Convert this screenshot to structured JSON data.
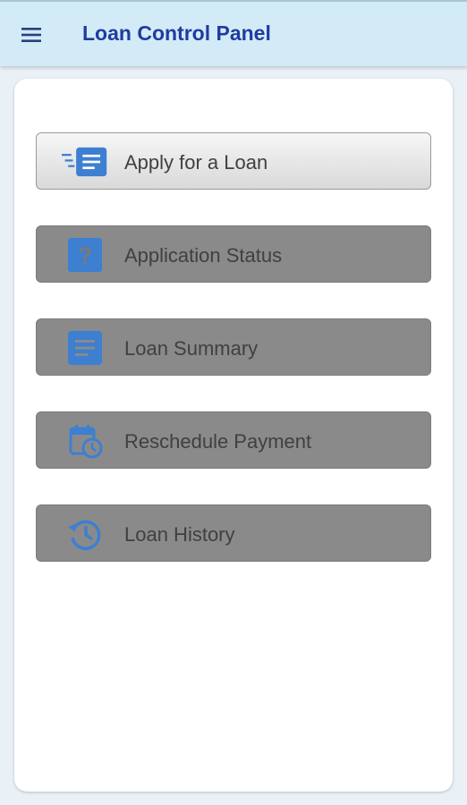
{
  "app_bar": {
    "title": "Loan Control Panel",
    "menu_icon": "hamburger-menu-icon"
  },
  "colors": {
    "title": "#1f3c9e",
    "app_bar_bg": "#d3ebf7",
    "icon_blue": "#3d7fd1",
    "disabled_button": "#8a8a8a"
  },
  "menu": {
    "items": [
      {
        "label": "Apply for a Loan",
        "icon": "list-form-icon",
        "active": true
      },
      {
        "label": "Application Status",
        "icon": "question-mark-icon",
        "active": false
      },
      {
        "label": "Loan Summary",
        "icon": "document-icon",
        "active": false
      },
      {
        "label": "Reschedule Payment",
        "icon": "calendar-clock-icon",
        "active": false
      },
      {
        "label": "Loan History",
        "icon": "history-icon",
        "active": false
      }
    ]
  }
}
